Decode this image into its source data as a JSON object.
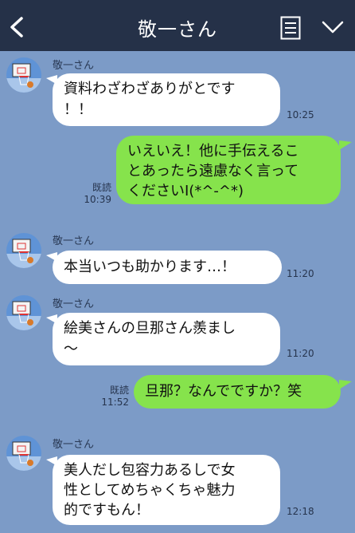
{
  "header": {
    "title": "敬一さん",
    "icons": [
      "back-chevron-icon",
      "memo-icon",
      "chevron-down-icon"
    ]
  },
  "colors": {
    "header_bg": "#253148",
    "chat_bg": "#7c9bc7",
    "incoming_bubble": "#ffffff",
    "outgoing_bubble": "#86e34c"
  },
  "messages": [
    {
      "sender": "敬一さん",
      "lines": [
        "資料わざわざありがとです",
        "！！"
      ],
      "time": "10:25"
    },
    {
      "lines": [
        "いえいえ！他に手伝えるこ",
        "とあったら遠慮なく言って",
        "くださいI(*^-^*)"
      ],
      "read": "既読",
      "time": "10:39"
    },
    {
      "sender": "敬一さん",
      "lines": [
        "本当いつも助かります…！"
      ],
      "time": "11:20"
    },
    {
      "sender": "敬一さん",
      "lines": [
        "絵美さんの旦那さん羨まし",
        "〜"
      ],
      "time": "11:20"
    },
    {
      "lines": [
        "旦那？なんでですか？笑"
      ],
      "read": "既読",
      "time": "11:52"
    },
    {
      "sender": "敬一さん",
      "lines": [
        "美人だし包容力あるしで女",
        "性としてめちゃくちゃ魅力",
        "的ですもん！"
      ],
      "time": "12:18"
    }
  ]
}
